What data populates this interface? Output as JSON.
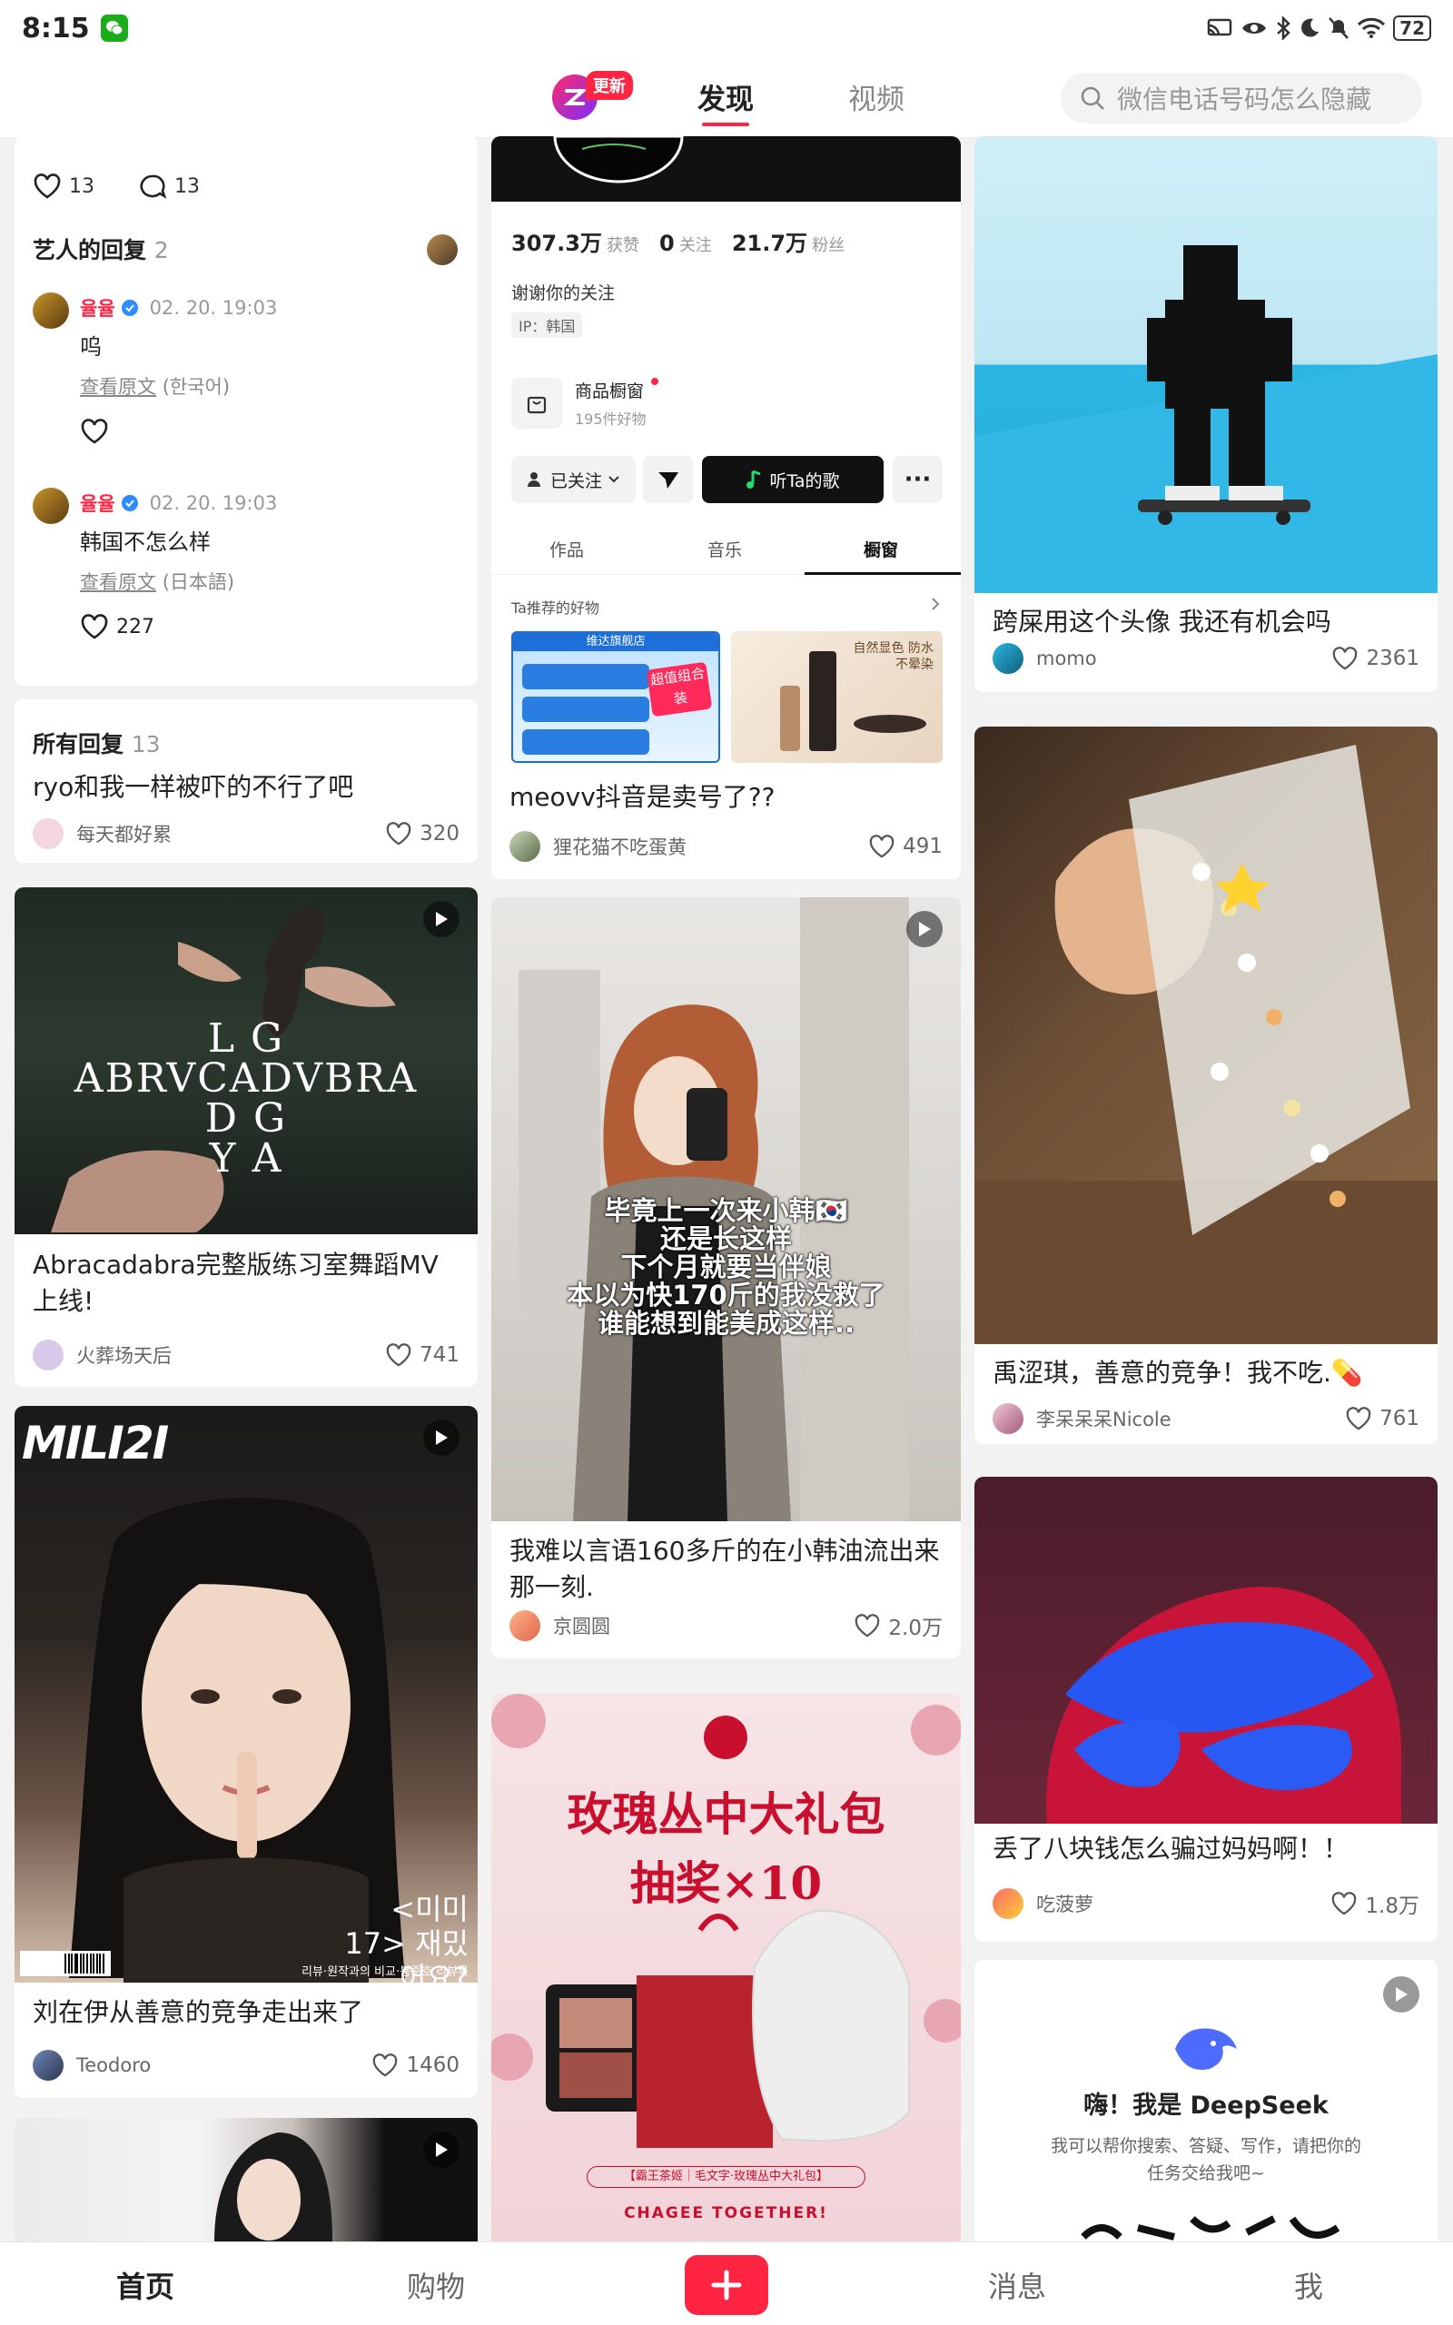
{
  "status_bar": {
    "time": "8:15",
    "battery": "72"
  },
  "top_nav": {
    "update_badge": "更新",
    "tabs": [
      {
        "label": "发现",
        "active": true
      },
      {
        "label": "视频",
        "active": false
      }
    ],
    "search_placeholder": "微信电话号码怎么隐藏"
  },
  "col1": {
    "comment_card": {
      "likes": "13",
      "comments": "13",
      "artist_replies_label": "艺人的回复",
      "artist_replies_count": "2",
      "replies": [
        {
          "name": "율율",
          "time": "02. 20. 19:03",
          "text": "呜",
          "view_original": "查看原文",
          "original_lang": "(한국어)",
          "likes": ""
        },
        {
          "name": "율율",
          "time": "02. 20. 19:03",
          "text": "韩国不怎么样",
          "view_original": "查看原文",
          "original_lang": "(日本語)",
          "likes": "227"
        }
      ]
    },
    "all_replies": {
      "label": "所有回复",
      "count": "13",
      "text": "ryo和我一样被吓的不行了吧",
      "user": "每天都好累",
      "likes": "320"
    },
    "posts": [
      {
        "image_text": [
          "L  G",
          "ABRVCADVBRA",
          "D  G",
          "Y  A"
        ],
        "caption": "Abracadabra完整版练习室舞蹈MV上线!",
        "user": "火葬场天后",
        "likes": "741"
      },
      {
        "cover_logo": "MILI2I",
        "cover_korean": "<미미 17> 재밌어요?",
        "cover_small": "리뷰·원작과의 비교·봉준호 리뷰룩",
        "caption": "刘在伊从善意的竞争走出来了",
        "user": "Teodoro",
        "likes": "1460"
      }
    ]
  },
  "col2": {
    "profile_card": {
      "stats": [
        {
          "value": "307.3万",
          "label": "获赞"
        },
        {
          "value": "0",
          "label": "关注"
        },
        {
          "value": "21.7万",
          "label": "粉丝"
        }
      ],
      "bio": "谢谢你的关注",
      "ip": "IP：韩国",
      "shop_title": "商品橱窗",
      "shop_sub": "195件好物",
      "followed": "已关注",
      "listen": "听Ta的歌",
      "tabs": [
        "作品",
        "音乐",
        "橱窗"
      ],
      "recommend": "Ta推荐的好物",
      "product1_store": "维达旗舰店",
      "product1_badge": "超值组合装",
      "product2_text": "自然显色 防水不晕染",
      "caption": "meovv抖音是卖号了??",
      "user": "狸花猫不吃蛋黄",
      "likes": "491"
    },
    "video_post": {
      "overlay_lines": [
        "毕竟上一次来小韩🇰🇷",
        "还是长这样",
        "下个月就要当伴娘",
        "本以为快170斤的我没救了",
        "谁能想到能美成这样.."
      ],
      "caption": "我难以言语160多斤的在小韩油流出来那一刻.",
      "user": "京圆圆",
      "likes": "2.0万"
    },
    "promo_post": {
      "title_line1": "玫瑰丛中大礼包",
      "title_line2": "抽奖×10",
      "strip_text": "【霸王茶姬｜毛文字·玫瑰丛中大礼包】",
      "brand": "CHAGEE TOGETHER!"
    }
  },
  "col3": {
    "posts": [
      {
        "caption": "跨屎用这个头像 我还有机会吗",
        "user": "momo",
        "likes": "2361"
      },
      {
        "caption": "禹涩琪，善意的竞争！我不吃.💊",
        "user": "李呆呆呆Nicole",
        "likes": "761"
      },
      {
        "caption": "丢了八块钱怎么骗过妈妈啊！！",
        "user": "吃菠萝",
        "likes": "1.8万"
      }
    ],
    "deepseek": {
      "title": "嗨！我是 DeepSeek",
      "desc_line1": "我可以帮你搜索、答疑、写作，请把你的",
      "desc_line2": "任务交给我吧~"
    }
  },
  "bottom_nav": {
    "items": [
      "首页",
      "购物",
      "消息",
      "我"
    ],
    "active": "首页"
  }
}
